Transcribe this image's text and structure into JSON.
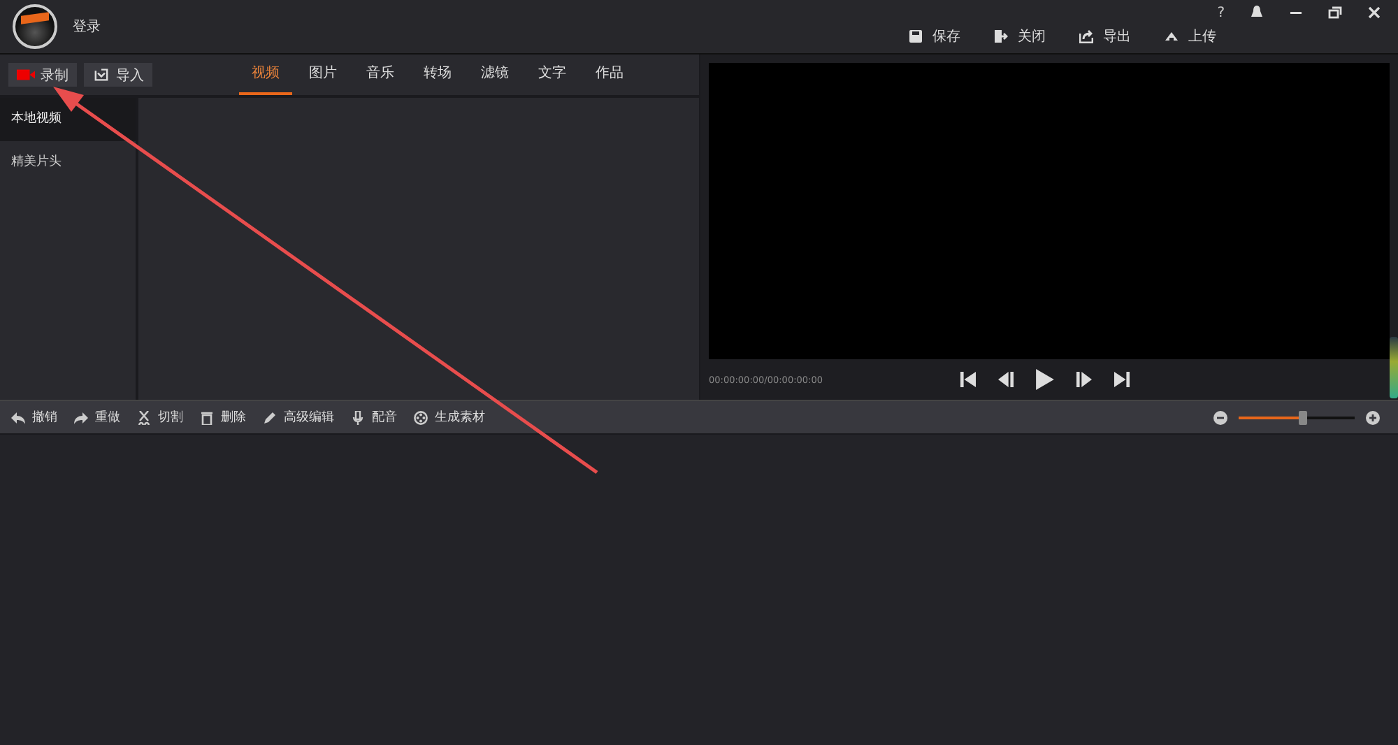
{
  "header": {
    "login": "登录"
  },
  "window_controls": [
    "?"
  ],
  "actions": [
    "保存",
    "关闭",
    "导出",
    "上传"
  ],
  "source_buttons": [
    {
      "label": "录制",
      "kind": "record"
    },
    {
      "label": "导入",
      "kind": "import"
    }
  ],
  "tabs": [
    {
      "label": "视频",
      "selected": true
    },
    {
      "label": "图片",
      "selected": false
    },
    {
      "label": "音乐",
      "selected": false
    },
    {
      "label": "转场",
      "selected": false
    },
    {
      "label": "滤镜",
      "selected": false
    },
    {
      "label": "文字",
      "selected": false
    },
    {
      "label": "作品",
      "selected": false
    }
  ],
  "sidebar": {
    "items": [
      {
        "label": "本地视频",
        "selected": true
      },
      {
        "label": "精美片头",
        "selected": false
      }
    ]
  },
  "preview": {
    "timecode": "00:00:00:00/00:00:00:00"
  },
  "timeline_tools": [
    "撤销",
    "重做",
    "切割",
    "删除",
    "高级编辑",
    "配音",
    "生成素材"
  ],
  "zoom": {
    "level": 0.56
  }
}
